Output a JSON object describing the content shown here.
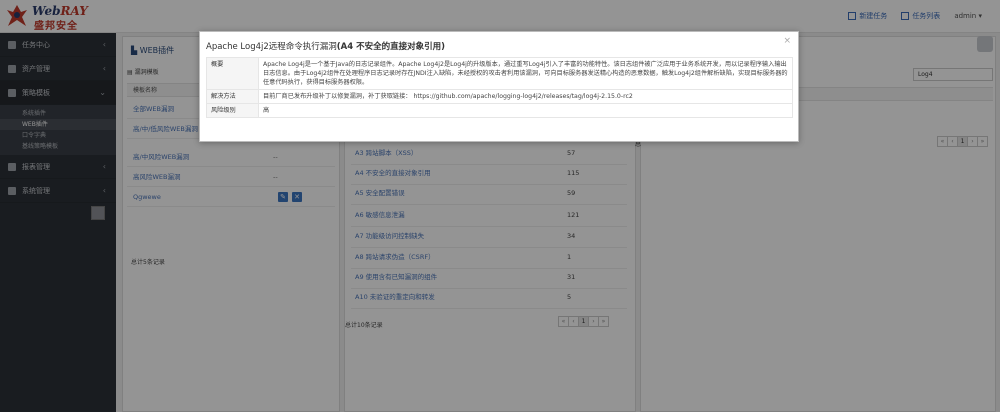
{
  "header": {
    "brand_prefix": "Web",
    "brand_suffix": "RAY",
    "brand_cn": "盛邦安全",
    "new_task": "新建任务",
    "task_list": "任务列表",
    "user": "admin",
    "user_caret": "▾"
  },
  "sidebar": {
    "items": [
      {
        "label": "任务中心",
        "caret": "‹"
      },
      {
        "label": "资产管理",
        "caret": "‹"
      },
      {
        "label": "策略模板",
        "caret": "⌄"
      },
      {
        "label": "报表管理",
        "caret": "‹"
      },
      {
        "label": "系统管理",
        "caret": "‹"
      }
    ],
    "sub_items": [
      "系统插件",
      "WEB插件",
      "口令字典",
      "基线策略模板"
    ]
  },
  "left_panel": {
    "title": "WEB插件",
    "subtitle": "漏洞模板",
    "column": "模板名称",
    "rows": [
      {
        "name": "全部WEB漏洞",
        "dash": ""
      },
      {
        "name": "高/中/低风险WEB漏洞",
        "dash": ""
      },
      {
        "name": "高/中风险WEB漏洞",
        "dash": "--"
      },
      {
        "name": "高风险WEB漏洞",
        "dash": "--"
      },
      {
        "name": "Qgwewe",
        "dash": ""
      }
    ],
    "total": "总计5条记录"
  },
  "mid_panel": {
    "rows": [
      {
        "name": "A3 跨站脚本（XSS）",
        "count": "57"
      },
      {
        "name": "A4 不安全的直接对象引用",
        "count": "115"
      },
      {
        "name": "A5 安全配置错误",
        "count": "59"
      },
      {
        "name": "A6 敏感信息泄漏",
        "count": "121"
      },
      {
        "name": "A7 功能级访问控制缺失",
        "count": "34"
      },
      {
        "name": "A8 跨站请求伪造（CSRF）",
        "count": "1"
      },
      {
        "name": "A9 使用含有已知漏洞的组件",
        "count": "31"
      },
      {
        "name": "A10 未验证的重定向和转发",
        "count": "5"
      }
    ],
    "total": "总计10条记录"
  },
  "right_panel": {
    "search_value": "Log4",
    "total_partial": "总"
  },
  "pager": {
    "first": "«",
    "prev": "‹",
    "page": "1",
    "next": "›",
    "last": "»"
  },
  "modal": {
    "title_plain": "Apache Log4j2远程命令执行漏洞",
    "title_bold": "(A4 不安全的直接对象引用)",
    "close": "×",
    "rows": [
      {
        "label": "概要",
        "value": "Apache Log4j是一个基于Java的日志记录组件。Apache Log4j2是Log4j的升级版本，通过重写Log4j引入了丰富的功能特性。该日志组件被广泛应用于业务系统开发，用以记录程序输入输出日志信息。由于Log4j2组件在处理程序日志记录时存在JNDI注入缺陷，未经授权的攻击者利用该漏洞，可向目标服务器发送精心构造的恶意数据，触发Log4j2组件解析缺陷，实现目标服务器的任意代码执行，获得目标服务器权限。"
      },
      {
        "label": "解决方法",
        "value": "目前厂商已发布升级补丁以修复漏洞，补丁获取链接： https://github.com/apache/logging-log4j2/releases/tag/log4j-2.15.0-rc2"
      },
      {
        "label": "风险级别",
        "value": "高"
      }
    ]
  }
}
